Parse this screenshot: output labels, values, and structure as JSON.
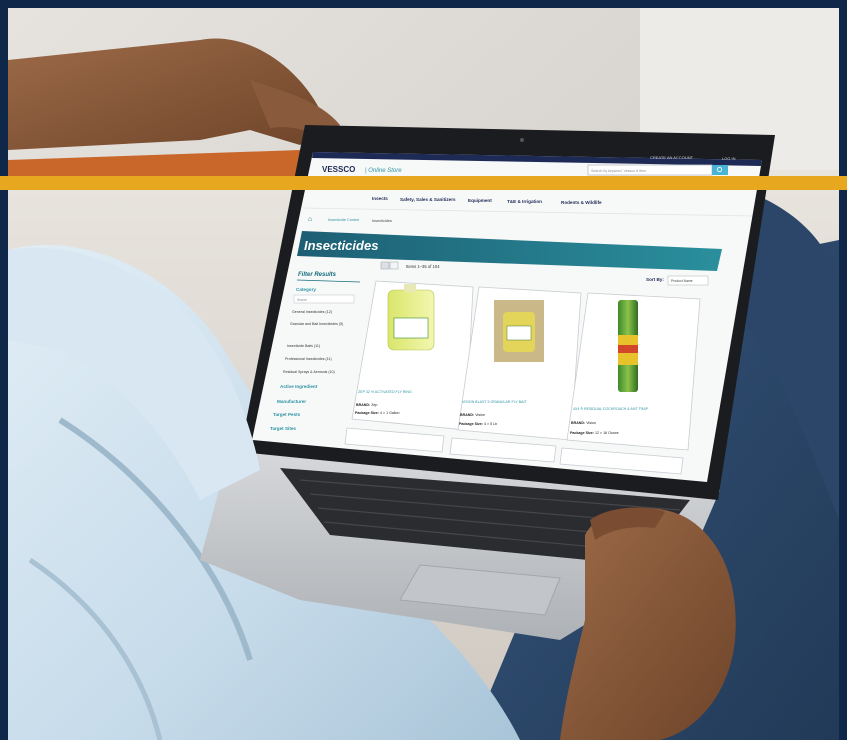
{
  "colors": {
    "frame_navy": "#0f2748",
    "gold_band": "#e7a820",
    "site_teal": "#1a6e7e",
    "site_navy": "#1d2a55",
    "link_teal": "#2d94a4",
    "search_button": "#4ab4d6",
    "wall": "#d9d5d0",
    "sofa": "#e3dfd8",
    "shirt": "#cfe0ec",
    "jeans": "#2f4a6d",
    "skin": "#8a5a3c",
    "laptop": "#c9cbce"
  },
  "site": {
    "brand": "VESSCO",
    "brand_suffix": "| Online Store",
    "top_links": [
      "CREATE AN ACCOUNT",
      "LOG IN"
    ],
    "search_placeholder": "Search by keyword, Vessco # item",
    "nav": [
      "Insects",
      "Safety, Sales & Sanitizers",
      "Equipment",
      "T&E & Irrigation",
      "Rodents & Wildlife"
    ],
    "breadcrumb": [
      "Insecticide Control",
      "Insecticides"
    ],
    "page_title": "Insecticides",
    "filter_title": "Filter Results",
    "filters": {
      "category_label": "Category",
      "category_search": "Search",
      "options": [
        "General Insecticides (12)",
        "Granular and Bait Insecticides (5)",
        "Insecticide Baits (11)",
        "Professional Insecticides (11)",
        "Residual Sprays & Aerosols (10)"
      ],
      "sections": [
        "Active Ingredient",
        "Manufacturer",
        "Target Pests",
        "Target Sites"
      ]
    },
    "results": {
      "count_text": "Items 1–35 of 104",
      "sort_label": "Sort By:",
      "sort_value": "Product Name",
      "products": [
        {
          "name": "ZEP 32 % ACTIVATED FLY RING",
          "brand_label": "BRAND:",
          "brand": "Zep",
          "pkg_label": "Package Size:",
          "pkg": "4 × 1 Gallon"
        },
        {
          "name": "VISION BLAST 5 GRANULAR FLY BAIT",
          "brand_label": "BRAND:",
          "brand": "Vision",
          "pkg_label": "Package Size:",
          "pkg": "4 × 5 Lb"
        },
        {
          "name": "4X4 ® RESIDUAL COCKROACH & ANT TRAP",
          "brand_label": "BRAND:",
          "brand": "Vision",
          "pkg_label": "Package Size:",
          "pkg": "12 × 16 Ounce"
        }
      ]
    }
  }
}
